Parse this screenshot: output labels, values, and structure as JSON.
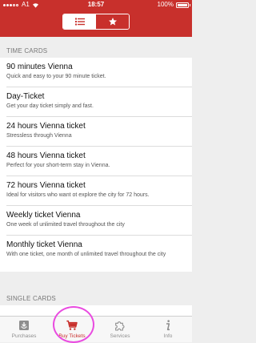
{
  "status_bar": {
    "carrier": "A1",
    "time": "18:57",
    "battery": "100%"
  },
  "segmented": {
    "list_icon": "list-icon",
    "star_icon": "star-icon"
  },
  "sections": [
    {
      "title": "TIME CARDS",
      "items": [
        {
          "title": "90 minutes Vienna",
          "subtitle": "Quick and easy to your 90 minute ticket."
        },
        {
          "title": "Day-Ticket",
          "subtitle": "Get your day ticket simply and fast."
        },
        {
          "title": "24 hours Vienna ticket",
          "subtitle": "Stressless through Vienna"
        },
        {
          "title": "48 hours Vienna ticket",
          "subtitle": "Perfect for your short-term stay in Vienna."
        },
        {
          "title": "72 hours Vienna ticket",
          "subtitle": "Ideal for visitors who want ot explore the city for 72 hours."
        },
        {
          "title": "Weekly ticket Vienna",
          "subtitle": "One week of unlimited travel throughout the city"
        },
        {
          "title": "Monthly ticket Vienna",
          "subtitle": "With one ticket, one month of unlimited travel throughout the city"
        }
      ]
    },
    {
      "title": "SINGLE CARDS"
    }
  ],
  "tabs": [
    {
      "label": "Purchases",
      "icon": "download-tray-icon"
    },
    {
      "label": "Buy Tickets",
      "icon": "shopping-cart-icon"
    },
    {
      "label": "Services",
      "icon": "puzzle-icon"
    },
    {
      "label": "Info",
      "icon": "info-icon"
    }
  ],
  "colors": {
    "brand": "#c8302c",
    "highlight": "#e94be0"
  }
}
